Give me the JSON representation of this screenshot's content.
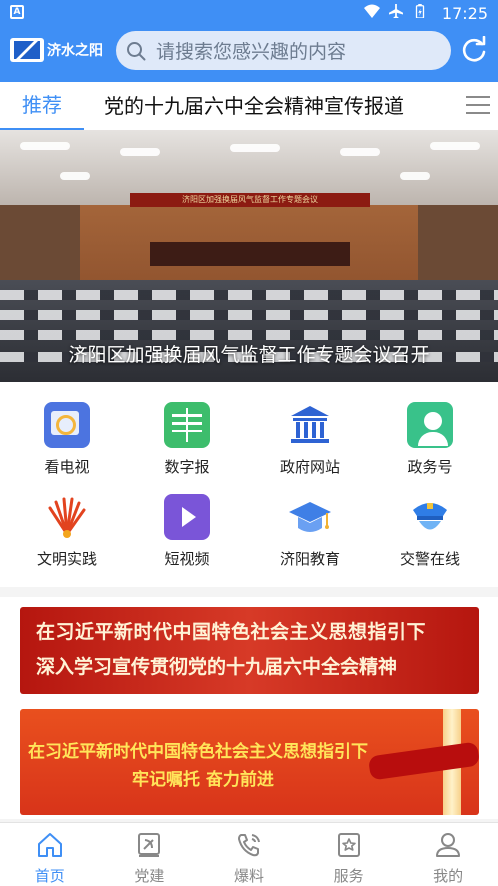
{
  "status_bar": {
    "time": "17:25",
    "notification_icon": "app-notification-icon"
  },
  "header": {
    "app_name": "济水之阳",
    "search_placeholder": "请搜索您感兴趣的内容",
    "accent": "#3f8ff5"
  },
  "tabs": [
    {
      "label": "推荐",
      "active": true
    },
    {
      "label": "党的十九届六中全会精神宣传报道",
      "active": false
    }
  ],
  "banner": {
    "caption": "济阳区加强换届风气监督工作专题会议召开",
    "sign_text": "济阳区加强换届风气监督工作专题会议"
  },
  "quick_links": [
    {
      "label": "看电视",
      "icon": "tv-icon"
    },
    {
      "label": "数字报",
      "icon": "newspaper-icon"
    },
    {
      "label": "政府网站",
      "icon": "government-building-icon"
    },
    {
      "label": "政务号",
      "icon": "official-account-icon"
    },
    {
      "label": "文明实践",
      "icon": "civilization-practice-icon"
    },
    {
      "label": "短视频",
      "icon": "short-video-icon"
    },
    {
      "label": "济阳教育",
      "icon": "education-cap-icon"
    },
    {
      "label": "交警在线",
      "icon": "traffic-police-icon"
    }
  ],
  "promos": [
    {
      "line1": "在习近平新时代中国特色社会主义思想指引下",
      "line2": "深入学习宣传贯彻党的十九届六中全会精神"
    },
    {
      "line1": "在习近平新时代中国特色社会主义思想指引下",
      "line2": "牢记嘱托 奋力前进"
    }
  ],
  "bottom_nav": [
    {
      "label": "首页",
      "icon": "home-icon",
      "active": true
    },
    {
      "label": "党建",
      "icon": "party-building-icon",
      "active": false
    },
    {
      "label": "爆料",
      "icon": "hotline-icon",
      "active": false
    },
    {
      "label": "服务",
      "icon": "service-star-icon",
      "active": false
    },
    {
      "label": "我的",
      "icon": "profile-icon",
      "active": false
    }
  ]
}
